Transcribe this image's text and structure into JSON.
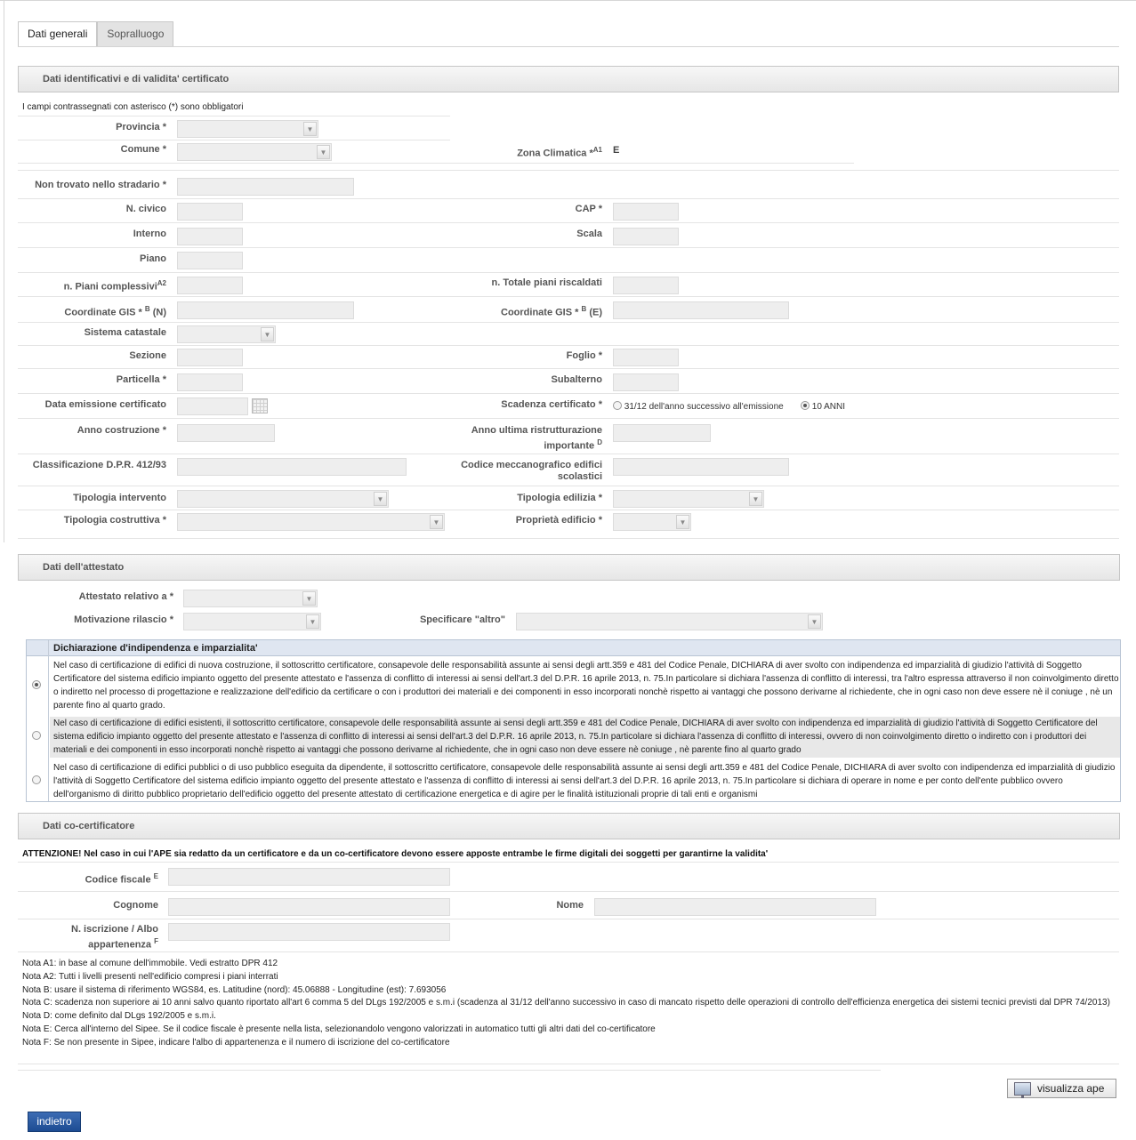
{
  "tabs": [
    "Dati generali",
    "Sopralluogo"
  ],
  "section1": {
    "title": "Dati identificativi e di validita' certificato",
    "required_note": "I campi contrassegnati con asterisco (*) sono obbligatori",
    "provincia": "Provincia *",
    "comune": "Comune *",
    "zona_climatica": "Zona Climatica *",
    "zona_climatica_sup": "A1",
    "zona_climatica_value": "E",
    "non_trovato": "Non trovato nello stradario *",
    "n_civico": "N. civico",
    "cap": "CAP *",
    "interno": "Interno",
    "scala": "Scala",
    "piano": "Piano",
    "piani_complessivi": "n. Piani complessivi",
    "piani_complessivi_sup": "A2",
    "piani_riscaldati": "n. Totale piani riscaldati",
    "coord_n_a": "Coordinate GIS *",
    "coord_sup": "B",
    "coord_n_b": "(N)",
    "coord_e_a": "Coordinate GIS *",
    "coord_e_b": "(E)",
    "sistema_catastale": "Sistema catastale",
    "sezione": "Sezione",
    "foglio": "Foglio *",
    "particella": "Particella *",
    "subalterno": "Subalterno",
    "data_emissione": "Data emissione certificato",
    "scadenza": "Scadenza certificato *",
    "scadenza_opt1": "31/12 dell'anno successivo all'emissione",
    "scadenza_opt2": "10 ANNI",
    "anno_costruzione": "Anno costruzione *",
    "anno_ristrutt_1": "Anno ultima ristrutturazione",
    "anno_ristrutt_2": "importante",
    "anno_ristrutt_sup": "D",
    "classificazione": "Classificazione D.P.R. 412/93",
    "codice_mecc_1": "Codice meccanografico edifici",
    "codice_mecc_2": "scolastici",
    "tipologia_intervento": "Tipologia intervento",
    "tipologia_edilizia": "Tipologia edilizia *",
    "tipologia_costruttiva": "Tipologia costruttiva *",
    "proprieta_edificio": "Proprietà edificio *"
  },
  "section2": {
    "title": "Dati dell'attestato",
    "attestato_relativo": "Attestato relativo a *",
    "motivazione": "Motivazione rilascio *",
    "specificare": "Specificare \"altro\""
  },
  "declaration": {
    "title": "Dichiarazione d'indipendenza e imparzialita'",
    "rows": [
      "Nel caso di certificazione di edifici di nuova costruzione, il sottoscritto certificatore, consapevole delle responsabilità assunte ai sensi degli artt.359 e 481 del Codice Penale, DICHIARA di aver svolto con indipendenza ed imparzialità di giudizio l'attività di Soggetto Certificatore del sistema edificio impianto oggetto del presente attestato e l'assenza di conflitto di interessi ai sensi dell'art.3 del D.P.R. 16 aprile 2013, n. 75.In particolare si dichiara l'assenza di conflitto di interessi, tra l'altro espressa attraverso il non coinvolgimento diretto o indiretto nel processo di progettazione e realizzazione dell'edificio da certificare o con i produttori dei materiali e dei componenti in esso incorporati nonchè rispetto ai vantaggi che possono derivarne al richiedente, che in ogni caso non deve essere nè il coniuge , nè un parente fino al quarto grado.",
      "Nel caso di certificazione di edifici esistenti, il sottoscritto certificatore, consapevole delle responsabilità assunte ai sensi degli artt.359 e 481 del Codice Penale, DICHIARA di aver svolto con indipendenza ed imparzialità di giudizio l'attività di Soggetto Certificatore del sistema edificio impianto oggetto del presente attestato e l'assenza di conflitto di interessi ai sensi dell'art.3 del D.P.R. 16 aprile 2013, n. 75.In particolare si dichiara l'assenza di conflitto di interessi, ovvero di non coinvolgimento diretto o indiretto con i produttori dei materiali e dei componenti in esso incorporati nonchè rispetto ai vantaggi che possono derivarne al richiedente, che in ogni caso non deve essere nè coniuge , nè parente fino al quarto grado",
      "Nel caso di certificazione di edifici pubblici o di uso pubblico eseguita da dipendente, il sottoscritto certificatore, consapevole delle responsabilità assunte ai sensi degli artt.359 e 481 del Codice Penale, DICHIARA di aver svolto con indipendenza ed imparzialità di giudizio l'attività di Soggetto Certificatore del sistema edificio impianto oggetto del presente attestato e l'assenza di conflitto di interessi ai sensi dell'art.3 del D.P.R. 16 aprile 2013, n. 75.In particolare si dichiara di operare in nome e per conto dell'ente pubblico ovvero dell'organismo di diritto pubblico proprietario dell'edificio oggetto del presente attestato di certificazione energetica e di agire per le finalità istituzionali proprie di tali enti e organismi"
    ]
  },
  "section3": {
    "title": "Dati co-certificatore",
    "warning": "ATTENZIONE! Nel caso in cui l'APE sia redatto da un certificatore e da un co-certificatore devono essere apposte entrambe le firme digitali dei soggetti per garantirne la validita'",
    "codice_fiscale": "Codice fiscale",
    "codice_fiscale_sup": "E",
    "cognome": "Cognome",
    "nome": "Nome",
    "iscrizione_1": "N. iscrizione / Albo",
    "iscrizione_2": "appartenenza",
    "iscrizione_sup": "F"
  },
  "notes": [
    "Nota A1: in base al comune dell'immobile. Vedi estratto DPR 412",
    "Nota A2: Tutti i livelli presenti nell'edificio compresi i piani interrati",
    "Nota B: usare il sistema di riferimento WGS84, es. Latitudine (nord): 45.06888 - Longitudine (est): 7.693056",
    "Nota C: scadenza non superiore ai 10 anni salvo quanto riportato all'art 6 comma 5 del DLgs 192/2005 e s.m.i (scadenza al 31/12 dell'anno successivo in caso di mancato rispetto delle operazioni di controllo dell'efficienza energetica dei sistemi tecnici previsti dal DPR 74/2013)",
    "Nota D: come definito dal DLgs 192/2005 e s.m.i.",
    "Nota E: Cerca all'interno del Sipee. Se il codice fiscale è presente nella lista, selezionandolo vengono valorizzati in automatico tutti gli altri dati del co-certificatore",
    "Nota F: Se non presente in Sipee, indicare l'albo di appartenenza e il numero di iscrizione del co-certificatore"
  ],
  "buttons": {
    "visualizza": "visualizza ape",
    "indietro": "indietro"
  }
}
